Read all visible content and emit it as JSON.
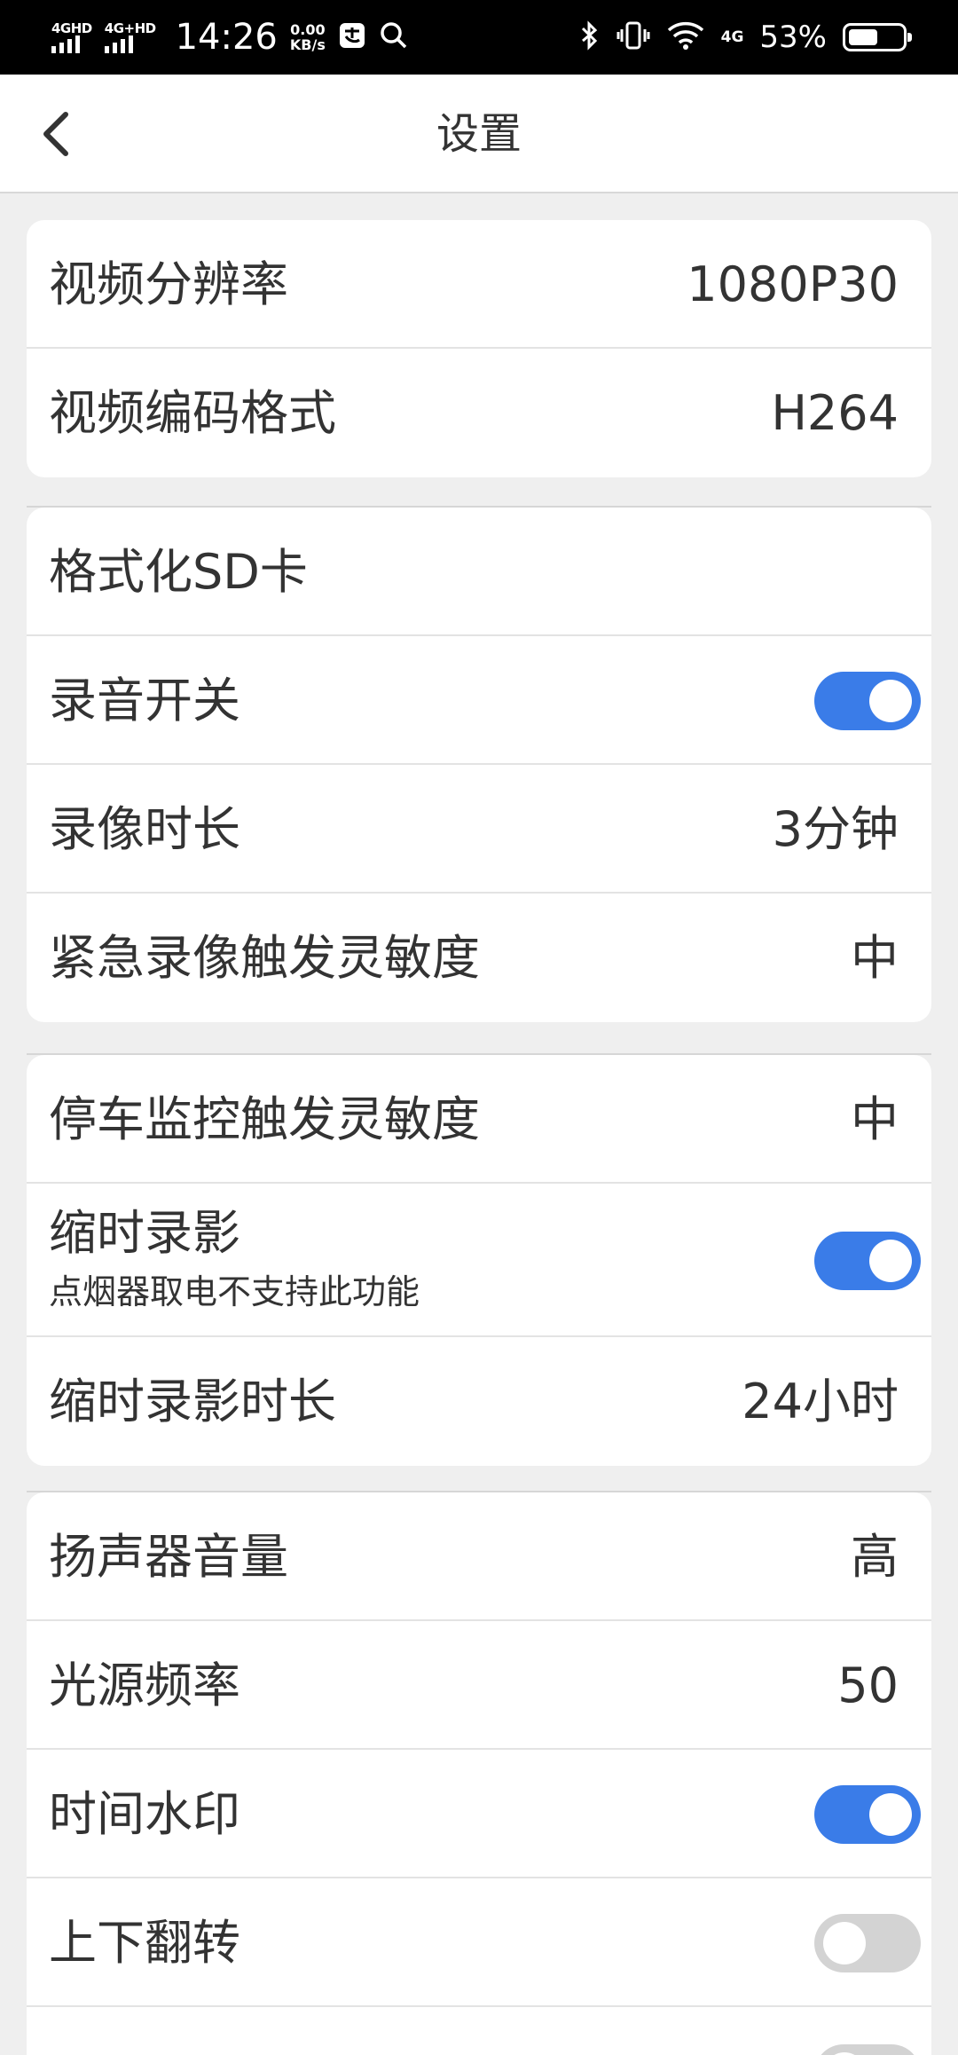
{
  "status_bar": {
    "sim1": "4GHD",
    "sim2": "4G+HD",
    "time": "14:26",
    "speed_value": "0.00",
    "speed_unit": "KB/s",
    "network": "4G",
    "battery_percent": "53%",
    "battery_level": 0.53,
    "icons": [
      "alipay-icon",
      "search-icon",
      "bluetooth-icon",
      "vibrate-icon",
      "wifi-icon",
      "battery-icon"
    ]
  },
  "navbar": {
    "title": "设置",
    "back_icon": "chevron-left-icon"
  },
  "accent_color": "#3a7ce8",
  "groups": {
    "video": {
      "resolution": {
        "label": "视频分辨率",
        "value": "1080P30"
      },
      "codec": {
        "label": "视频编码格式",
        "value": "H264"
      }
    },
    "recording": {
      "format_sd": {
        "label": "格式化SD卡"
      },
      "audio": {
        "label": "录音开关",
        "on": true
      },
      "duration": {
        "label": "录像时长",
        "value": "3分钟"
      },
      "emergency": {
        "label": "紧急录像触发灵敏度",
        "value": "中"
      }
    },
    "parking": {
      "monitor": {
        "label": "停车监控触发灵敏度",
        "value": "中"
      },
      "timelapse": {
        "label": "缩时录影",
        "note": "点烟器取电不支持此功能",
        "on": true
      },
      "timelapse_duration": {
        "label": "缩时录影时长",
        "value": "24小时"
      }
    },
    "general": {
      "speaker": {
        "label": "扬声器音量",
        "value": "高"
      },
      "light_freq": {
        "label": "光源频率",
        "value": "50"
      },
      "watermark": {
        "label": "时间水印",
        "on": true
      },
      "flip": {
        "label": "上下翻转",
        "on": false
      }
    }
  }
}
